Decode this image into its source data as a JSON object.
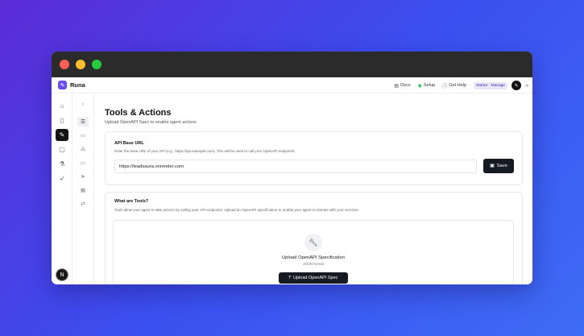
{
  "app": {
    "brand": "Runa"
  },
  "topbar": {
    "docs": "Docs",
    "setup": "Setup",
    "help": "Get Help",
    "plan": "Starter · Manage"
  },
  "page": {
    "title": "Tools & Actions",
    "subtitle": "Upload OpenAPI Spec to enable agent actions"
  },
  "api_url": {
    "heading": "API Base URL",
    "description": "Enter the base URL of your API (e.g., https://api.example.com). This will be used to call your OpenAPI endpoints.",
    "value": "https://leadsaura.onrender.com",
    "save_label": "Save"
  },
  "tools": {
    "heading": "What are Tools?",
    "description": "Tools allow your agent to take actions by calling your API endpoints. Upload an OpenAPI specification to enable your agent to interact with your services.",
    "upload_title": "Upload OpenAPI Specification",
    "upload_format": "JSON format",
    "upload_button": "Upload OpenAPI Spec"
  },
  "user": {
    "initial": "N"
  },
  "colors": {
    "accent": "#6a4cf0",
    "dark_button": "#161a22"
  }
}
